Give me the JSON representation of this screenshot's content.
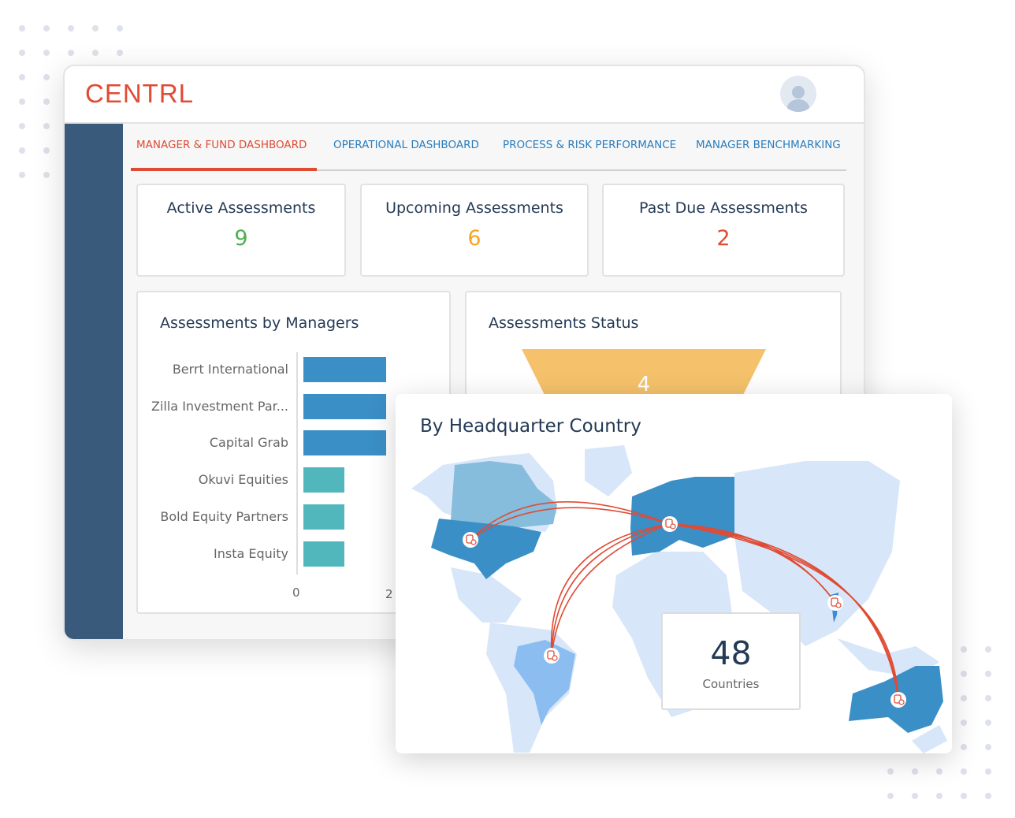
{
  "header": {
    "logo": "CENTRL",
    "avatar_icon": "user-avatar-icon"
  },
  "tabs": [
    {
      "label": "MANAGER & FUND DASHBOARD",
      "active": true
    },
    {
      "label": "OPERATIONAL DASHBOARD",
      "active": false
    },
    {
      "label": "PROCESS & RISK PERFORMANCE",
      "active": false
    },
    {
      "label": "MANAGER BENCHMARKING",
      "active": false
    }
  ],
  "stats": [
    {
      "label": "Active Assessments",
      "value": "9",
      "color": "#4caf50"
    },
    {
      "label": "Upcoming Assessments",
      "value": "6",
      "color": "#f5a623"
    },
    {
      "label": "Past Due Assessments",
      "value": "2",
      "color": "#e04b34"
    }
  ],
  "managers_chart": {
    "title": "Assessments by Managers",
    "chart_data": {
      "type": "bar",
      "orientation": "horizontal",
      "categories": [
        "Berrt International",
        "Zilla Investment Par...",
        "Capital Grab",
        "Okuvi Equities",
        "Bold Equity Partners",
        "Insta Equity"
      ],
      "values": [
        2,
        2,
        2,
        1,
        1,
        1
      ],
      "colors": [
        "#3a8fc6",
        "#3a8fc6",
        "#3a8fc6",
        "#52b6bd",
        "#52b6bd",
        "#52b6bd"
      ],
      "xticks": [
        "0",
        "2"
      ]
    }
  },
  "status_chart": {
    "title": "Assessments Status",
    "chart_data": {
      "type": "funnel",
      "values": [
        4
      ],
      "colors": [
        "#f5c26b"
      ]
    }
  },
  "map": {
    "title": "By Headquarter Country",
    "count": "48",
    "count_label": "Countries",
    "accent": "#e04b34",
    "highlight": "#3a8fc6"
  }
}
